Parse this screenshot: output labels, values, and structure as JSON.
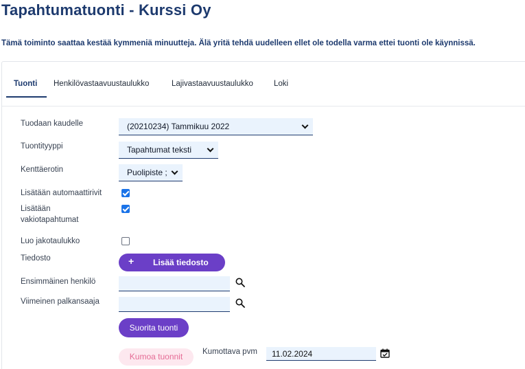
{
  "header": {
    "title": "Tapahtumatuonti - Kurssi Oy",
    "warning": "Tämä toiminto saattaa kestää kymmeniä minuutteja. Älä yritä tehdä uudelleen ellet ole todella varma ettei tuonti ole käynnissä."
  },
  "tabs": [
    {
      "label": "Tuonti",
      "active": true
    },
    {
      "label": "Henkilövastaavuustaulukko",
      "active": false
    },
    {
      "label": "Lajivastaavuustaulukko",
      "active": false
    },
    {
      "label": "Loki",
      "active": false
    }
  ],
  "form": {
    "period_label": "Tuodaan kaudelle",
    "period_value": "(20210234) Tammikuu 2022",
    "type_label": "Tuontityyppi",
    "type_value": "Tapahtumat teksti",
    "separator_label": "Kenttäerotin",
    "separator_value": "Puolipiste ;",
    "auto_rows_label": "Lisätään automaattirivit",
    "auto_rows_checked": true,
    "standard_events_label_1": "Lisätään",
    "standard_events_label_2": "vakiotapahtumat",
    "standard_events_checked": true,
    "allocation_label": "Luo jakotaulukko",
    "allocation_checked": false,
    "file_label": "Tiedosto",
    "add_file_icon": "+",
    "add_file_button": "Lisää tiedosto",
    "first_person_label": "Ensimmäinen henkilö",
    "first_person_value": "",
    "last_payee_label": "Viimeinen palkansaaja",
    "last_payee_value": "",
    "run_button": "Suorita tuonti",
    "cancel_button": "Kumoa tuonnit",
    "cancel_date_label": "Kumottava pvm",
    "cancel_date_value": "11.02.2024"
  },
  "colors": {
    "title": "#1d3a6e",
    "primary_button": "#6b3fc7",
    "input_bg": "#eaf3fd",
    "cancel_bg": "#fde8ef",
    "cancel_text": "#e56b95"
  },
  "icons": {
    "search": "search-icon",
    "calendar": "calendar-check-icon",
    "dropdown": "chevron-down-icon"
  }
}
